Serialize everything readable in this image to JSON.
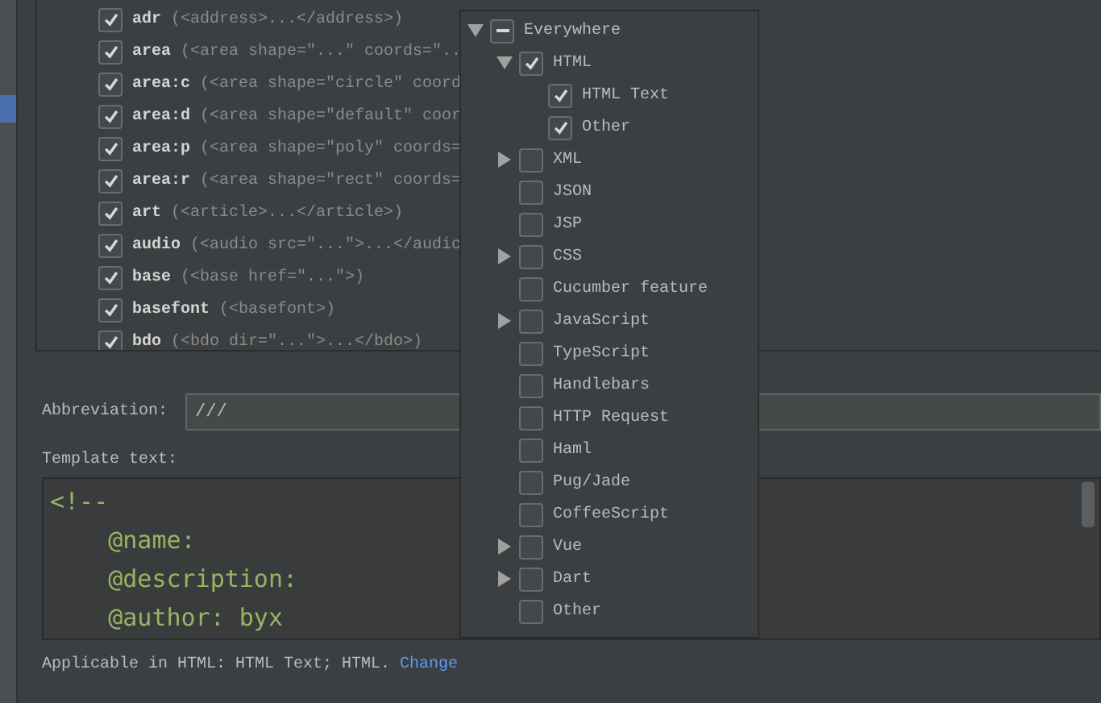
{
  "templates": [
    {
      "name": "adr",
      "description": "(<address>...</address>)",
      "checked": true
    },
    {
      "name": "area",
      "description": "(<area shape=\"...\" coords=\"..",
      "checked": true
    },
    {
      "name": "area:c",
      "description": "(<area shape=\"circle\" coord",
      "checked": true
    },
    {
      "name": "area:d",
      "description": "(<area shape=\"default\" coor",
      "checked": true
    },
    {
      "name": "area:p",
      "description": "(<area shape=\"poly\" coords=",
      "checked": true
    },
    {
      "name": "area:r",
      "description": "(<area shape=\"rect\" coords=",
      "checked": true
    },
    {
      "name": "art",
      "description": "(<article>...</article>)",
      "checked": true
    },
    {
      "name": "audio",
      "description": "(<audio src=\"...\">...</audic",
      "checked": true
    },
    {
      "name": "base",
      "description": "(<base href=\"...\">)",
      "checked": true
    },
    {
      "name": "basefont",
      "description": "(<basefont>)",
      "checked": true
    },
    {
      "name": "bdo",
      "description": "(<bdo dir=\"...\">...</bdo>)",
      "checked": true
    }
  ],
  "abbreviation": {
    "label": "Abbreviation:",
    "value": "///"
  },
  "template_text": {
    "label": "Template text:",
    "lines": [
      "<!--",
      "    @name:",
      "    @description:",
      "    @author: byx"
    ]
  },
  "applicable": {
    "text": "Applicable in HTML: HTML Text; HTML.",
    "link": "Change"
  },
  "contexts": [
    {
      "label": "Everywhere",
      "mixed": true,
      "expanded": true,
      "children": [
        {
          "label": "HTML",
          "checked": true,
          "expanded": true,
          "children": [
            {
              "label": "HTML Text",
              "checked": true
            },
            {
              "label": "Other",
              "checked": true
            }
          ]
        },
        {
          "label": "XML",
          "checked": false,
          "expanded": false
        },
        {
          "label": "JSON",
          "checked": false
        },
        {
          "label": "JSP",
          "checked": false
        },
        {
          "label": "CSS",
          "checked": false,
          "expanded": false
        },
        {
          "label": "Cucumber feature",
          "checked": false
        },
        {
          "label": "JavaScript",
          "checked": false,
          "expanded": false
        },
        {
          "label": "TypeScript",
          "checked": false
        },
        {
          "label": "Handlebars",
          "checked": false
        },
        {
          "label": "HTTP Request",
          "checked": false
        },
        {
          "label": "Haml",
          "checked": false
        },
        {
          "label": "Pug/Jade",
          "checked": false
        },
        {
          "label": "CoffeeScript",
          "checked": false
        },
        {
          "label": "Vue",
          "checked": false,
          "expanded": false
        },
        {
          "label": "Dart",
          "checked": false,
          "expanded": false
        },
        {
          "label": "Other",
          "checked": false
        }
      ]
    }
  ]
}
